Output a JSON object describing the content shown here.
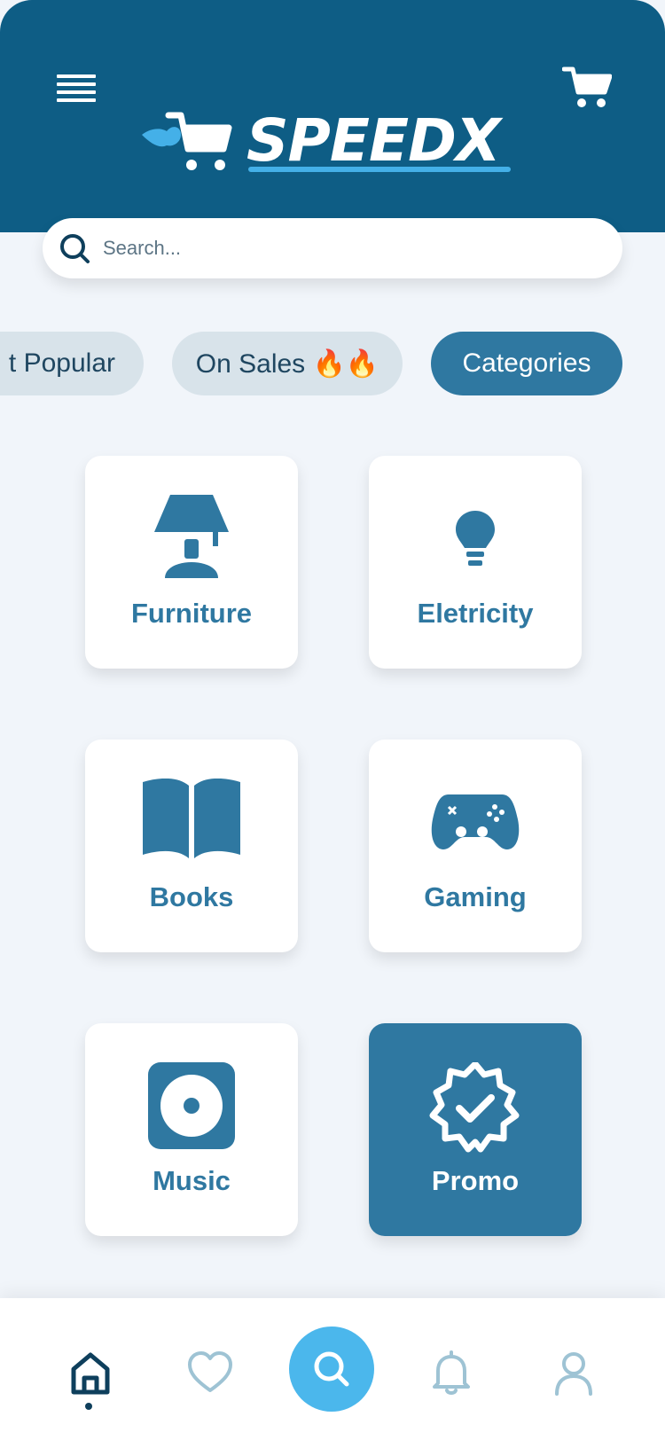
{
  "app": {
    "brand": "SPEEDX"
  },
  "search": {
    "placeholder": "Search..."
  },
  "tabs": [
    {
      "label": "t Popular",
      "active": false
    },
    {
      "label": "On Sales 🔥🔥",
      "active": false
    },
    {
      "label": "Categories",
      "active": true
    }
  ],
  "categories": [
    {
      "label": "Furniture",
      "icon": "lamp-icon",
      "active": false
    },
    {
      "label": "Eletricity",
      "icon": "lightbulb-icon",
      "active": false
    },
    {
      "label": "Books",
      "icon": "book-icon",
      "active": false
    },
    {
      "label": "Gaming",
      "icon": "gamepad-icon",
      "active": false
    },
    {
      "label": "Music",
      "icon": "speaker-icon",
      "active": false
    },
    {
      "label": "Promo",
      "icon": "badge-check-icon",
      "active": true
    }
  ],
  "bottom_nav": [
    {
      "id": "home",
      "icon": "home-icon",
      "active": true
    },
    {
      "id": "favorites",
      "icon": "heart-icon",
      "active": false
    },
    {
      "id": "search",
      "icon": "search-icon",
      "active": false
    },
    {
      "id": "notifications",
      "icon": "bell-icon",
      "active": false
    },
    {
      "id": "profile",
      "icon": "user-icon",
      "active": false
    }
  ],
  "colors": {
    "header": "#0e5d85",
    "accent": "#2f78a1",
    "accent_light": "#4bb7ec",
    "background": "#f1f5fa"
  }
}
